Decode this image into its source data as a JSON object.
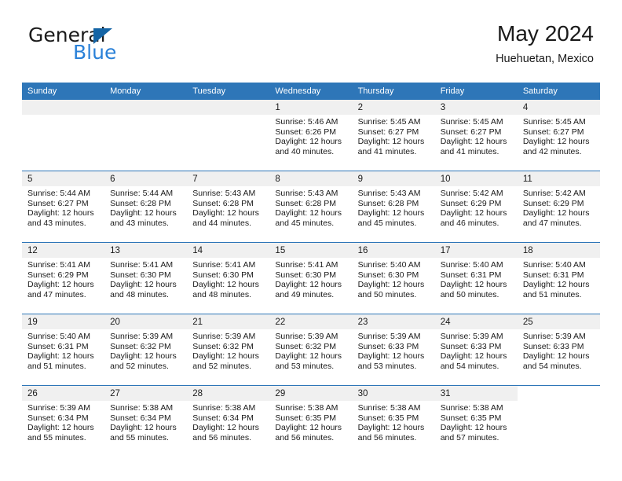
{
  "brand": {
    "name_part1": "General",
    "name_part2": "Blue",
    "logo_icon": "triangle-logo-icon"
  },
  "header": {
    "month_title": "May 2024",
    "location": "Huehuetan, Mexico",
    "accent_color": "#2e76b8",
    "band_color": "#f0f0f0"
  },
  "calendar": {
    "weekday_headers": [
      "Sunday",
      "Monday",
      "Tuesday",
      "Wednesday",
      "Thursday",
      "Friday",
      "Saturday"
    ],
    "weeks": [
      [
        {
          "day": "",
          "lines": []
        },
        {
          "day": "",
          "lines": []
        },
        {
          "day": "",
          "lines": []
        },
        {
          "day": "1",
          "lines": [
            "Sunrise: 5:46 AM",
            "Sunset: 6:26 PM",
            "Daylight: 12 hours",
            "and 40 minutes."
          ]
        },
        {
          "day": "2",
          "lines": [
            "Sunrise: 5:45 AM",
            "Sunset: 6:27 PM",
            "Daylight: 12 hours",
            "and 41 minutes."
          ]
        },
        {
          "day": "3",
          "lines": [
            "Sunrise: 5:45 AM",
            "Sunset: 6:27 PM",
            "Daylight: 12 hours",
            "and 41 minutes."
          ]
        },
        {
          "day": "4",
          "lines": [
            "Sunrise: 5:45 AM",
            "Sunset: 6:27 PM",
            "Daylight: 12 hours",
            "and 42 minutes."
          ]
        }
      ],
      [
        {
          "day": "5",
          "lines": [
            "Sunrise: 5:44 AM",
            "Sunset: 6:27 PM",
            "Daylight: 12 hours",
            "and 43 minutes."
          ]
        },
        {
          "day": "6",
          "lines": [
            "Sunrise: 5:44 AM",
            "Sunset: 6:28 PM",
            "Daylight: 12 hours",
            "and 43 minutes."
          ]
        },
        {
          "day": "7",
          "lines": [
            "Sunrise: 5:43 AM",
            "Sunset: 6:28 PM",
            "Daylight: 12 hours",
            "and 44 minutes."
          ]
        },
        {
          "day": "8",
          "lines": [
            "Sunrise: 5:43 AM",
            "Sunset: 6:28 PM",
            "Daylight: 12 hours",
            "and 45 minutes."
          ]
        },
        {
          "day": "9",
          "lines": [
            "Sunrise: 5:43 AM",
            "Sunset: 6:28 PM",
            "Daylight: 12 hours",
            "and 45 minutes."
          ]
        },
        {
          "day": "10",
          "lines": [
            "Sunrise: 5:42 AM",
            "Sunset: 6:29 PM",
            "Daylight: 12 hours",
            "and 46 minutes."
          ]
        },
        {
          "day": "11",
          "lines": [
            "Sunrise: 5:42 AM",
            "Sunset: 6:29 PM",
            "Daylight: 12 hours",
            "and 47 minutes."
          ]
        }
      ],
      [
        {
          "day": "12",
          "lines": [
            "Sunrise: 5:41 AM",
            "Sunset: 6:29 PM",
            "Daylight: 12 hours",
            "and 47 minutes."
          ]
        },
        {
          "day": "13",
          "lines": [
            "Sunrise: 5:41 AM",
            "Sunset: 6:30 PM",
            "Daylight: 12 hours",
            "and 48 minutes."
          ]
        },
        {
          "day": "14",
          "lines": [
            "Sunrise: 5:41 AM",
            "Sunset: 6:30 PM",
            "Daylight: 12 hours",
            "and 48 minutes."
          ]
        },
        {
          "day": "15",
          "lines": [
            "Sunrise: 5:41 AM",
            "Sunset: 6:30 PM",
            "Daylight: 12 hours",
            "and 49 minutes."
          ]
        },
        {
          "day": "16",
          "lines": [
            "Sunrise: 5:40 AM",
            "Sunset: 6:30 PM",
            "Daylight: 12 hours",
            "and 50 minutes."
          ]
        },
        {
          "day": "17",
          "lines": [
            "Sunrise: 5:40 AM",
            "Sunset: 6:31 PM",
            "Daylight: 12 hours",
            "and 50 minutes."
          ]
        },
        {
          "day": "18",
          "lines": [
            "Sunrise: 5:40 AM",
            "Sunset: 6:31 PM",
            "Daylight: 12 hours",
            "and 51 minutes."
          ]
        }
      ],
      [
        {
          "day": "19",
          "lines": [
            "Sunrise: 5:40 AM",
            "Sunset: 6:31 PM",
            "Daylight: 12 hours",
            "and 51 minutes."
          ]
        },
        {
          "day": "20",
          "lines": [
            "Sunrise: 5:39 AM",
            "Sunset: 6:32 PM",
            "Daylight: 12 hours",
            "and 52 minutes."
          ]
        },
        {
          "day": "21",
          "lines": [
            "Sunrise: 5:39 AM",
            "Sunset: 6:32 PM",
            "Daylight: 12 hours",
            "and 52 minutes."
          ]
        },
        {
          "day": "22",
          "lines": [
            "Sunrise: 5:39 AM",
            "Sunset: 6:32 PM",
            "Daylight: 12 hours",
            "and 53 minutes."
          ]
        },
        {
          "day": "23",
          "lines": [
            "Sunrise: 5:39 AM",
            "Sunset: 6:33 PM",
            "Daylight: 12 hours",
            "and 53 minutes."
          ]
        },
        {
          "day": "24",
          "lines": [
            "Sunrise: 5:39 AM",
            "Sunset: 6:33 PM",
            "Daylight: 12 hours",
            "and 54 minutes."
          ]
        },
        {
          "day": "25",
          "lines": [
            "Sunrise: 5:39 AM",
            "Sunset: 6:33 PM",
            "Daylight: 12 hours",
            "and 54 minutes."
          ]
        }
      ],
      [
        {
          "day": "26",
          "lines": [
            "Sunrise: 5:39 AM",
            "Sunset: 6:34 PM",
            "Daylight: 12 hours",
            "and 55 minutes."
          ]
        },
        {
          "day": "27",
          "lines": [
            "Sunrise: 5:38 AM",
            "Sunset: 6:34 PM",
            "Daylight: 12 hours",
            "and 55 minutes."
          ]
        },
        {
          "day": "28",
          "lines": [
            "Sunrise: 5:38 AM",
            "Sunset: 6:34 PM",
            "Daylight: 12 hours",
            "and 56 minutes."
          ]
        },
        {
          "day": "29",
          "lines": [
            "Sunrise: 5:38 AM",
            "Sunset: 6:35 PM",
            "Daylight: 12 hours",
            "and 56 minutes."
          ]
        },
        {
          "day": "30",
          "lines": [
            "Sunrise: 5:38 AM",
            "Sunset: 6:35 PM",
            "Daylight: 12 hours",
            "and 56 minutes."
          ]
        },
        {
          "day": "31",
          "lines": [
            "Sunrise: 5:38 AM",
            "Sunset: 6:35 PM",
            "Daylight: 12 hours",
            "and 57 minutes."
          ]
        },
        {
          "day": "",
          "lines": [],
          "empty_tail": true
        }
      ]
    ]
  }
}
